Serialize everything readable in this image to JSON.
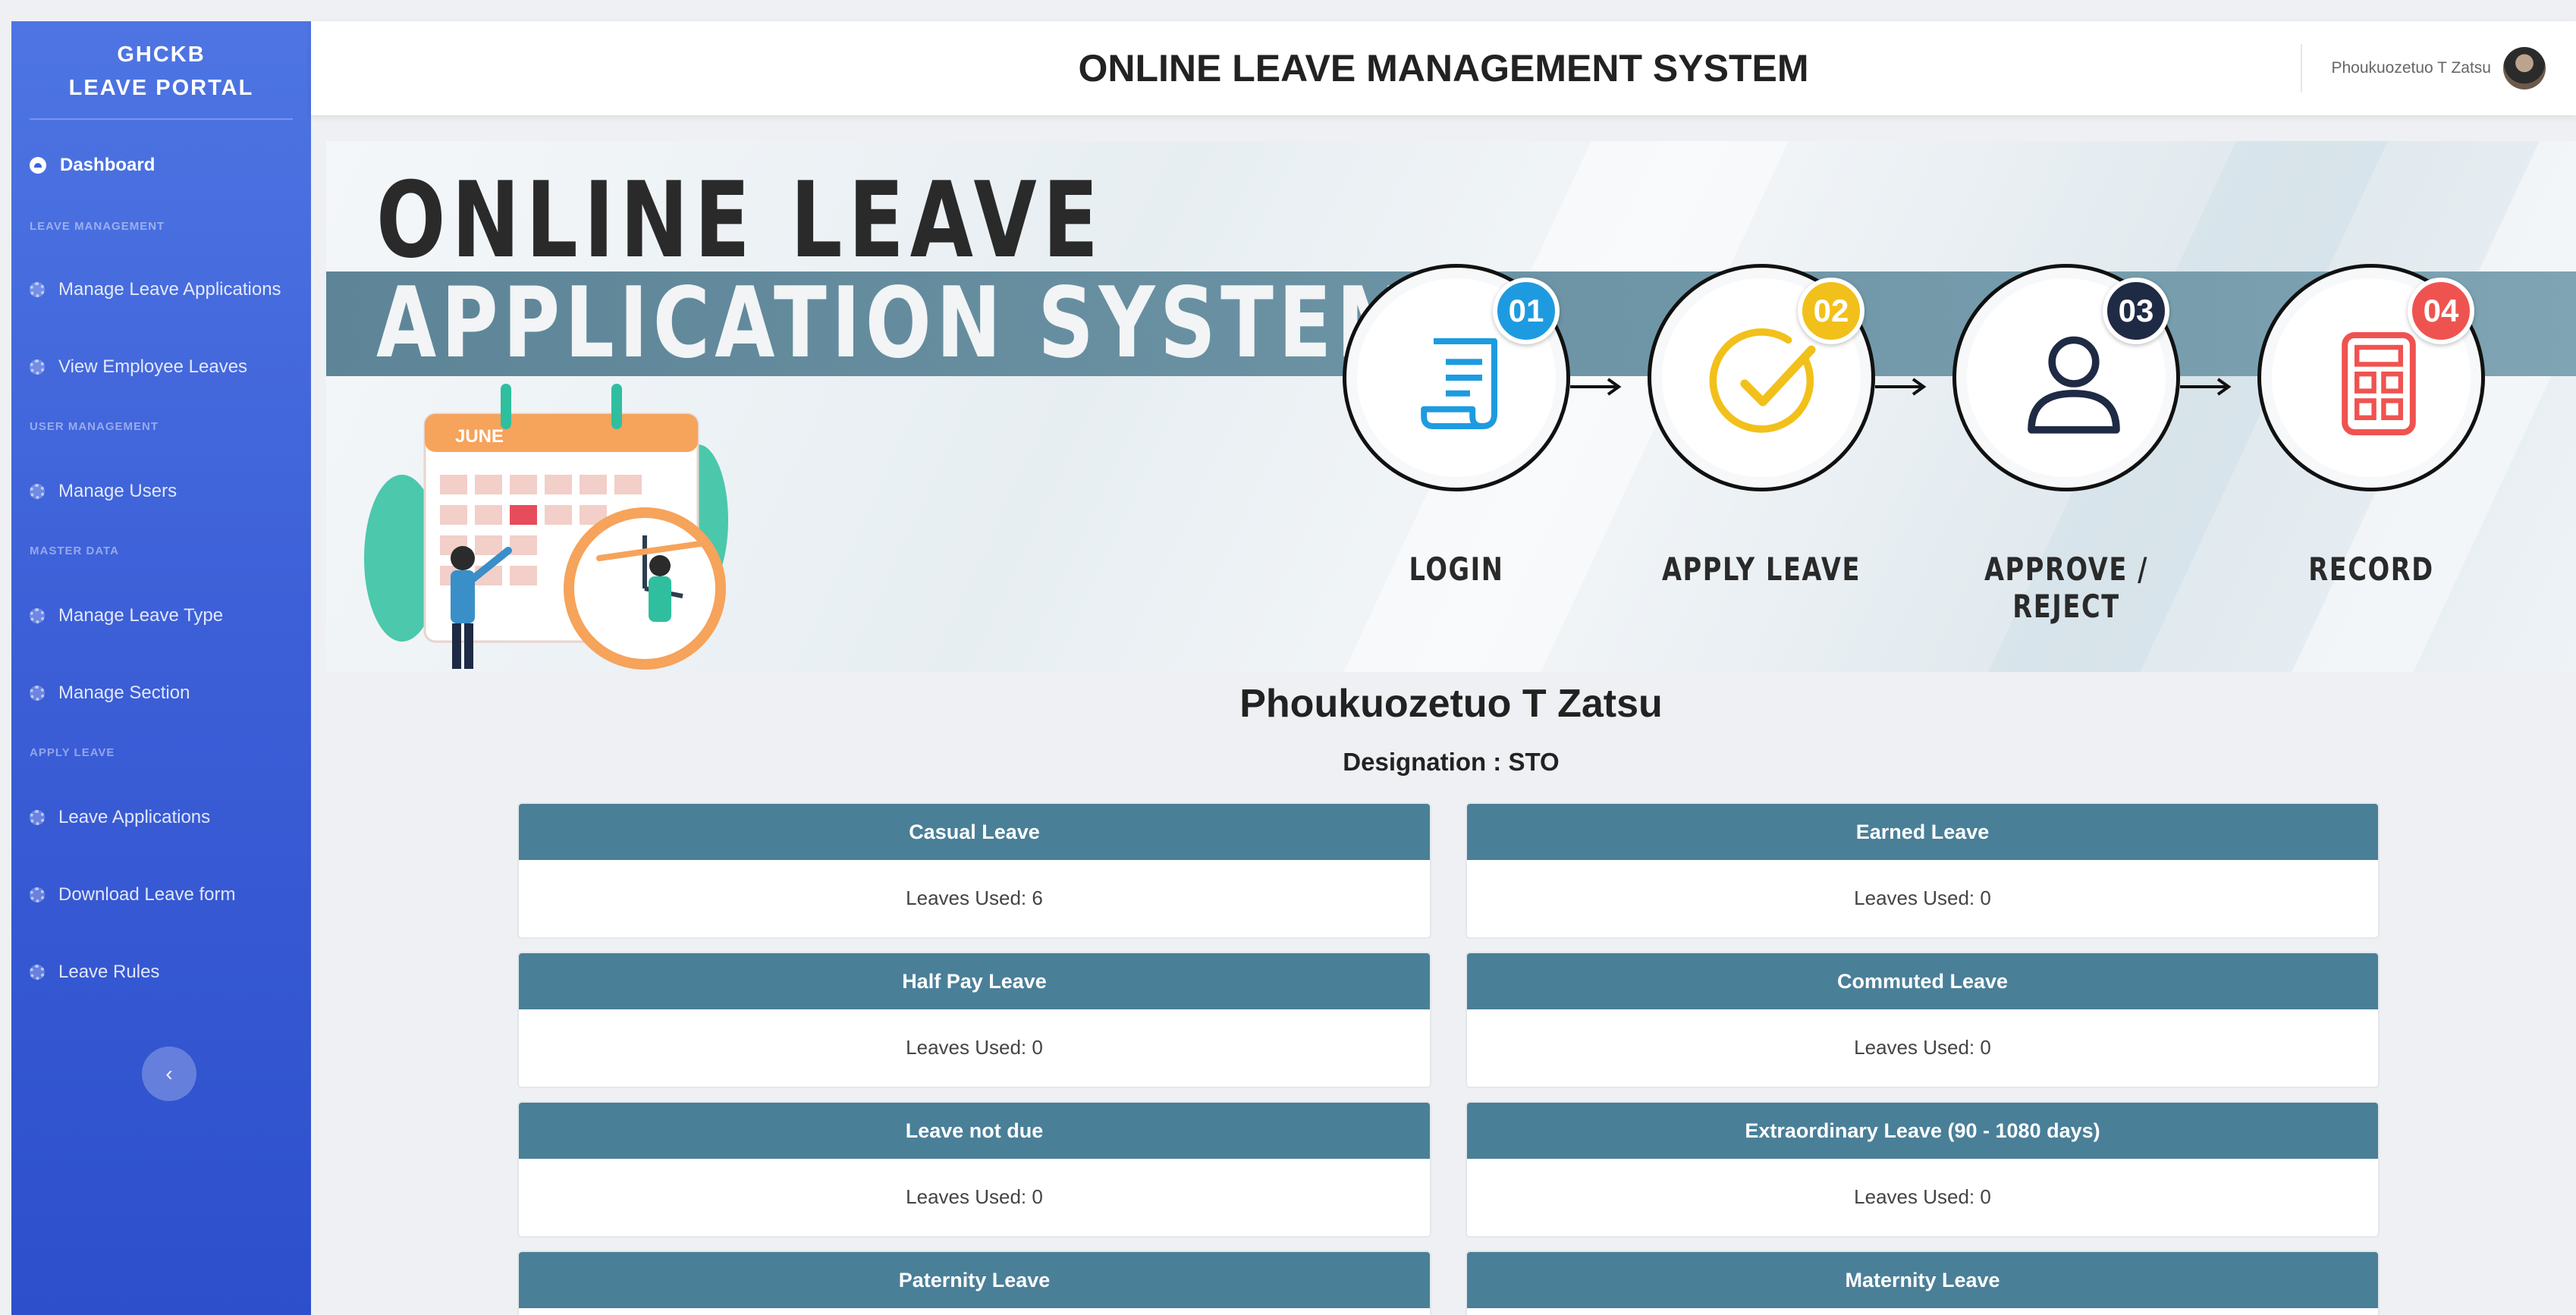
{
  "sidebar": {
    "brand_line1": "GHCKB",
    "brand_line2": "LEAVE PORTAL",
    "dashboard": "Dashboard",
    "headings": {
      "leave_management": "LEAVE MANAGEMENT",
      "user_management": "USER MANAGEMENT",
      "master_data": "MASTER DATA",
      "apply_leave": "APPLY LEAVE"
    },
    "items": {
      "manage_leave_applications": "Manage Leave Applications",
      "view_employee_leaves": "View Employee Leaves",
      "manage_users": "Manage Users",
      "manage_leave_type": "Manage Leave Type",
      "manage_section": "Manage Section",
      "leave_applications": "Leave Applications",
      "download_leave_form": "Download Leave form",
      "leave_rules": "Leave Rules"
    },
    "toggle": "‹"
  },
  "topbar": {
    "title": "ONLINE LEAVE MANAGEMENT SYSTEM",
    "username": "Phoukuozetuo T Zatsu"
  },
  "banner": {
    "title_line1": "ONLINE  LEAVE",
    "title_line2": "APPLICATION SYSTEM",
    "calendar_month": "JUNE",
    "steps": [
      {
        "num": "01",
        "label": "LOGIN",
        "color": "#1e9be0"
      },
      {
        "num": "02",
        "label": "APPLY  LEAVE",
        "color": "#f2c01a"
      },
      {
        "num": "03",
        "label": "APPROVE / REJECT",
        "color": "#1f2a44"
      },
      {
        "num": "04",
        "label": "RECORD",
        "color": "#ef5350"
      }
    ]
  },
  "profile": {
    "name": "Phoukuozetuo T Zatsu",
    "designation": "Designation : STO"
  },
  "cards": [
    {
      "title": "Casual Leave",
      "body": "Leaves Used: 6"
    },
    {
      "title": "Earned Leave",
      "body": "Leaves Used: 0"
    },
    {
      "title": "Half Pay Leave",
      "body": "Leaves Used: 0"
    },
    {
      "title": "Commuted Leave",
      "body": "Leaves Used: 0"
    },
    {
      "title": "Leave not due",
      "body": "Leaves Used: 0"
    },
    {
      "title": "Extraordinary Leave (90 - 1080 days)",
      "body": "Leaves Used: 0"
    },
    {
      "title": "Paternity Leave",
      "body": ""
    },
    {
      "title": "Maternity Leave",
      "body": ""
    }
  ]
}
